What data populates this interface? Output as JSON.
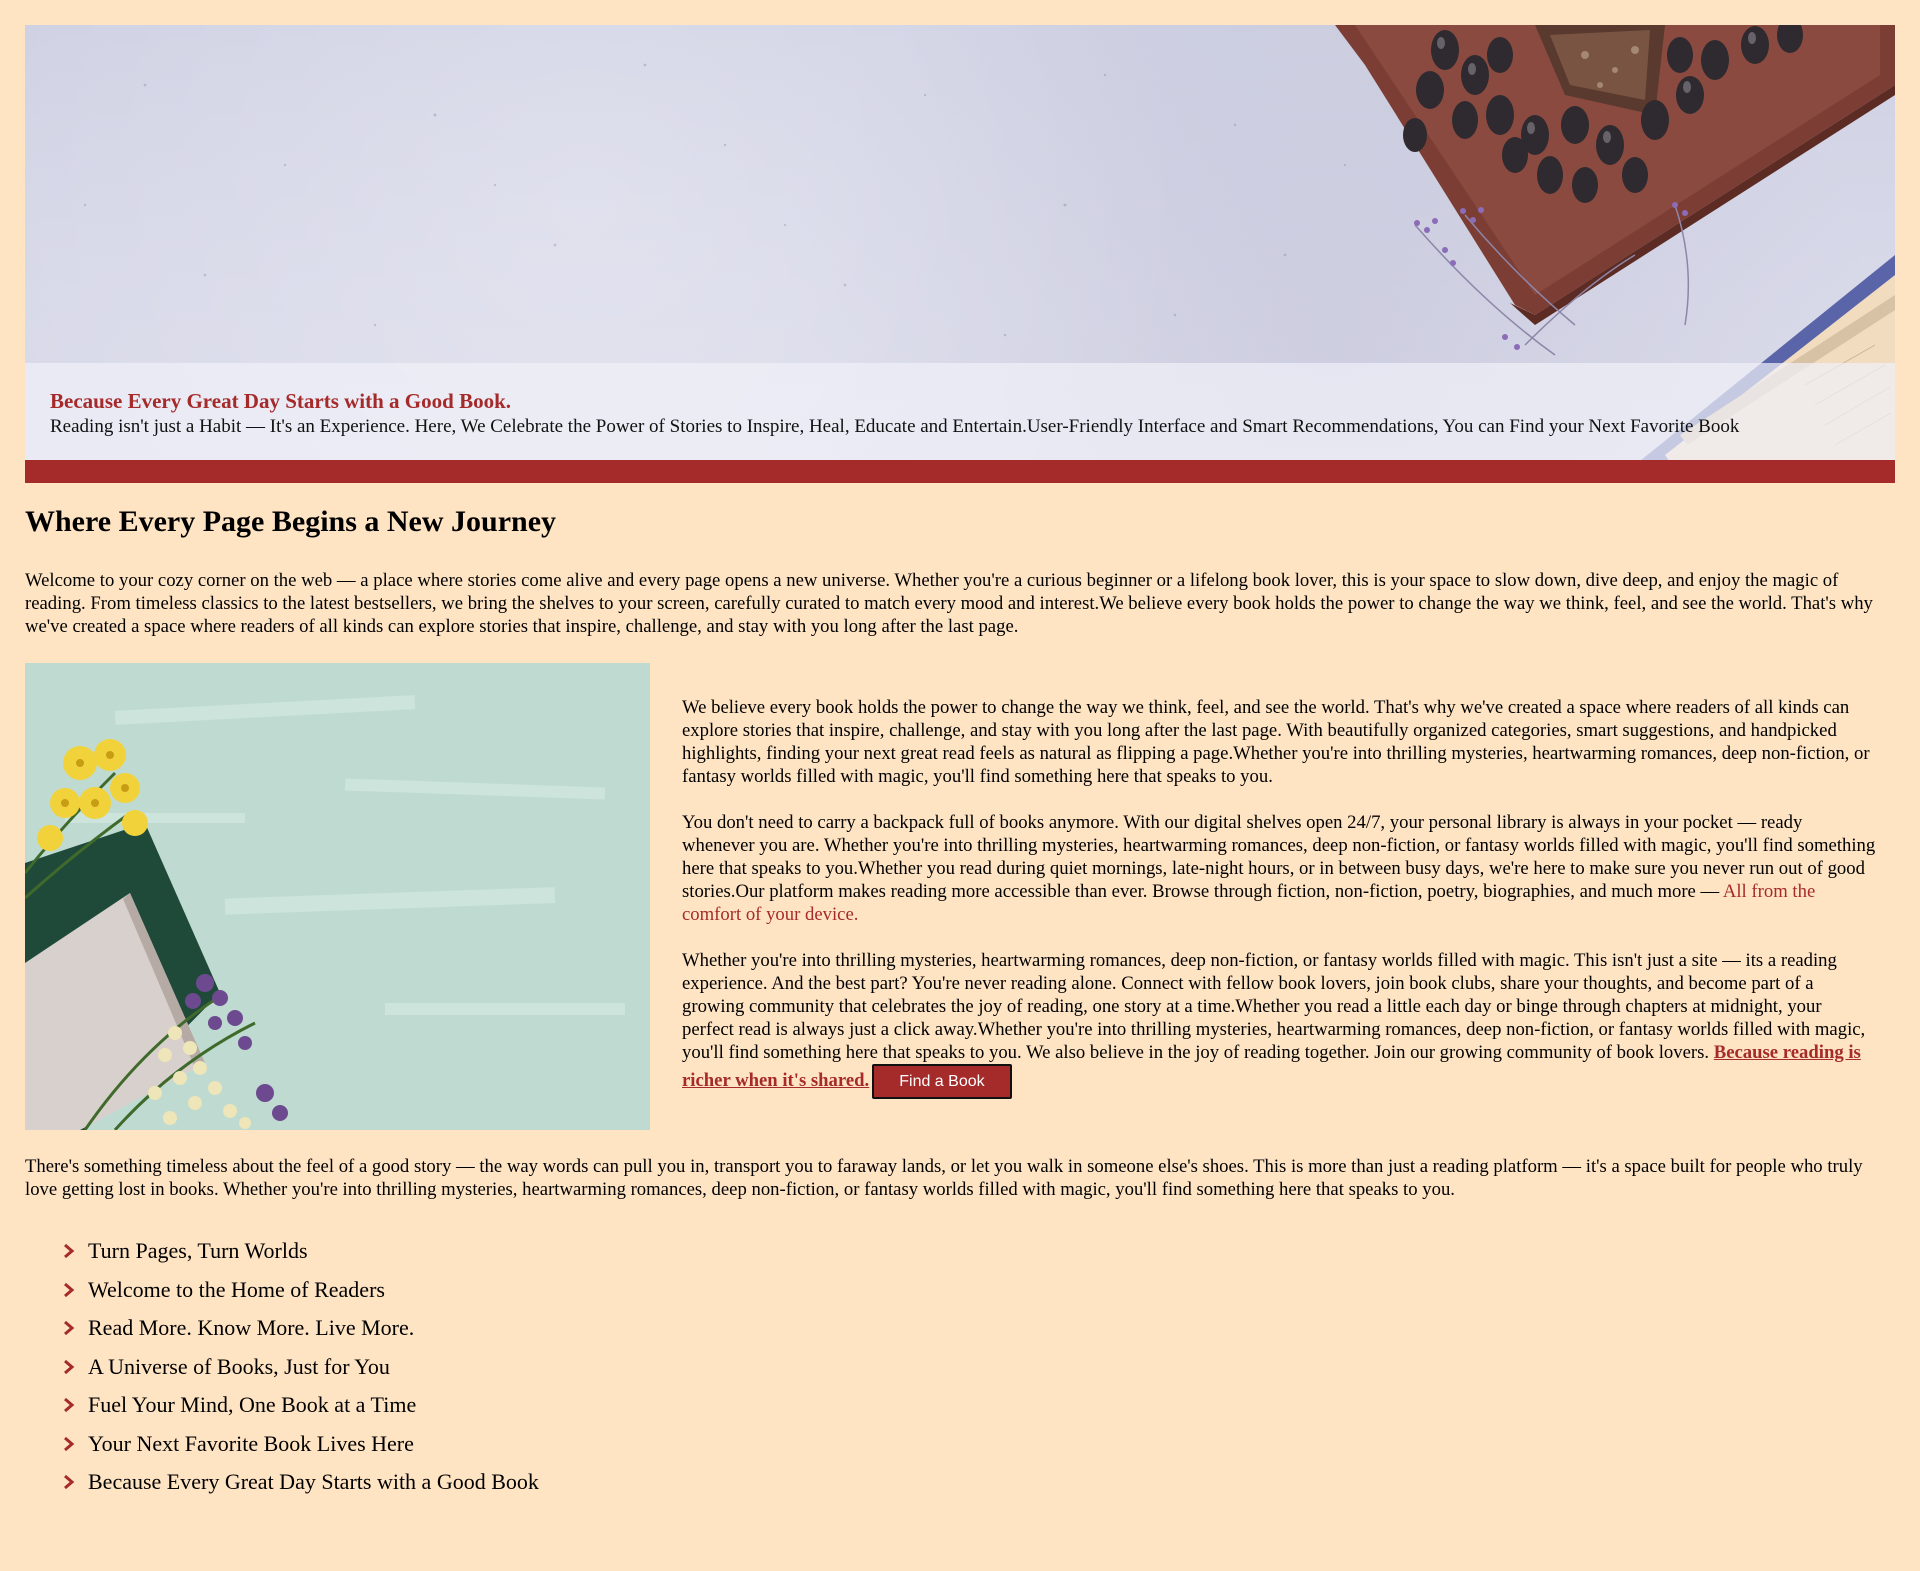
{
  "hero": {
    "title": "Because Every Great Day Starts with a Good Book.",
    "subtitle": "Reading isn't just a Habit — It's an Experience. Here, We Celebrate the Power of Stories to Inspire, Heal, Educate and Entertain.User-Friendly Interface and Smart Recommendations, You can Find your Next Favorite Book"
  },
  "main": {
    "heading": "Where Every Page Begins a New Journey",
    "intro": "Welcome to your cozy corner on the web — a place where stories come alive and every page opens a new universe. Whether you're a curious beginner or a lifelong book lover, this is your space to slow down, dive deep, and enjoy the magic of reading. From timeless classics to the latest bestsellers, we bring the shelves to your screen, carefully curated to match every mood and interest.We believe every book holds the power to change the way we think, feel, and see the world. That's why we've created a space where readers of all kinds can explore stories that inspire, challenge, and stay with you long after the last page.",
    "paragraph1": "We believe every book holds the power to change the way we think, feel, and see the world. That's why we've created a space where readers of all kinds can explore stories that inspire, challenge, and stay with you long after the last page. With beautifully organized categories, smart suggestions, and handpicked highlights, finding your next great read feels as natural as flipping a page.Whether you're into thrilling mysteries, heartwarming romances, deep non-fiction, or fantasy worlds filled with magic, you'll find something here that speaks to you.",
    "paragraph2": "You don't need to carry a backpack full of books anymore. With our digital shelves open 24/7, your personal library is always in your pocket — ready whenever you are. Whether you're into thrilling mysteries, heartwarming romances, deep non-fiction, or fantasy worlds filled with magic, you'll find something here that speaks to you.Whether you read during quiet mornings, late-night hours, or in between busy days, we're here to make sure you never run out of good stories.Our platform makes reading more accessible than ever. Browse through fiction, non-fiction, poetry, biographies, and much more — ",
    "paragraph2_accent": "All from the comfort of your device.",
    "paragraph3": "Whether you're into thrilling mysteries, heartwarming romances, deep non-fiction, or fantasy worlds filled with magic. This isn't just a site — its a reading experience. And the best part? You're never reading alone. Connect with fellow book lovers, join book clubs, share your thoughts, and become part of a growing community that celebrates the joy of reading, one story at a time.Whether you read a little each day or binge through chapters at midnight, your perfect read is always just a click away.Whether you're into thrilling mysteries, heartwarming romances, deep non-fiction, or fantasy worlds filled with magic, you'll find something here that speaks to you. We also believe in the joy of reading together. Join our growing community of book lovers. ",
    "paragraph3_link": "Because reading is richer when it's shared.",
    "button_label": "Find a Book",
    "outro": "There's something timeless about the feel of a good story — the way words can pull you in, transport you to faraway lands, or let you walk in someone else's shoes. This is more than just a reading platform — it's a space built for people who truly love getting lost in books. Whether you're into thrilling mysteries, heartwarming romances, deep non-fiction, or fantasy worlds filled with magic, you'll find something here that speaks to you."
  },
  "taglines": [
    "Turn Pages, Turn Worlds",
    "Welcome to the Home of Readers",
    "Read More. Know More. Live More.",
    "A Universe of Books, Just for You",
    "Fuel Your Mind, One Book at a Time",
    "Your Next Favorite Book Lives Here",
    "Because Every Great Day Starts with a Good Book"
  ],
  "icons": {
    "list_marker": "chevron-right-icon"
  },
  "colors": {
    "page_background": "#ffe4c4",
    "accent": "#a52a2a",
    "text": "#000000"
  }
}
